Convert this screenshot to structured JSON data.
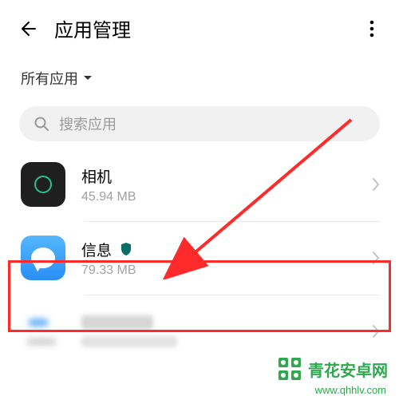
{
  "header": {
    "title": "应用管理"
  },
  "filter": {
    "label": "所有应用"
  },
  "search": {
    "placeholder": "搜索应用"
  },
  "apps": [
    {
      "name": "相机",
      "size": "45.94 MB",
      "has_shield": false
    },
    {
      "name": "信息",
      "size": "79.33 MB",
      "has_shield": true
    }
  ],
  "watermark": {
    "title": "青花安卓网",
    "url": "www.qhhlv.com"
  },
  "annotation": {
    "highlight_color": "#ff2a2a",
    "arrow_color": "#ff2a2a"
  }
}
